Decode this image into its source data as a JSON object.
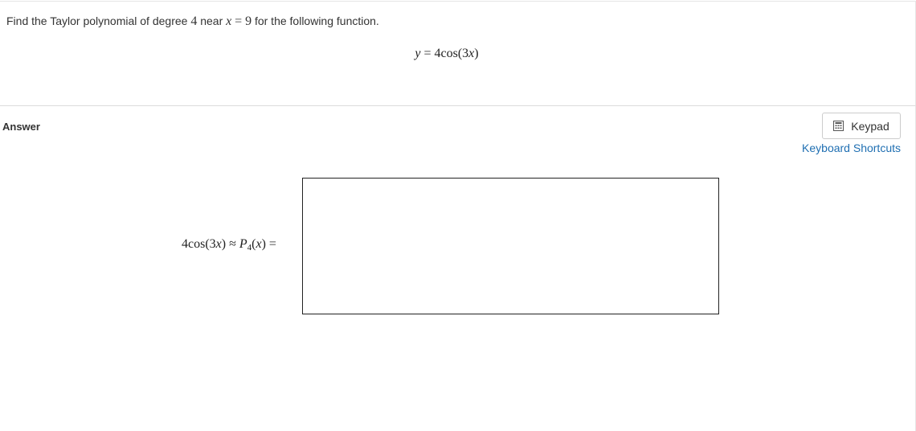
{
  "question": {
    "prefix": "Find the Taylor polynomial of degree",
    "degree": "4",
    "near_word": "near",
    "var": "x",
    "equals": "=",
    "center": "9",
    "suffix": "for the following function."
  },
  "display_equation": {
    "lhs": "y",
    "equals": "=",
    "coef": "4cos(3",
    "var": "x",
    "close": ")"
  },
  "answer": {
    "label": "Answer",
    "keypad_label": "Keypad",
    "keypad_icon": "calculator-icon",
    "shortcuts_label": "Keyboard Shortcuts",
    "lhs_coef": "4cos(3",
    "lhs_var": "x",
    "lhs_close": ")",
    "approx": "≈",
    "poly_name": "P",
    "poly_subscript": "4",
    "poly_open": "(",
    "poly_var": "x",
    "poly_close": ")",
    "equals": "=",
    "input_value": ""
  },
  "colors": {
    "link": "#1f6fb2",
    "border": "#cccccc",
    "input_border": "#222222",
    "text": "#333333"
  }
}
